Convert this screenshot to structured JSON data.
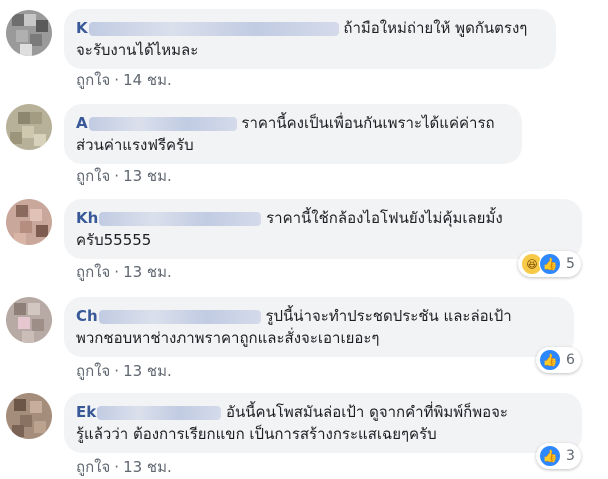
{
  "comments": [
    {
      "name_visible": "K",
      "text_line1": "ถ้ามือใหม่ถ่ายให้ พูดกันตรงๆ",
      "text_line2": "จะรับงานได้ไหมละ",
      "like_label": "ถูกใจ",
      "time": "14 ชม.",
      "reactions": null
    },
    {
      "name_visible": "A",
      "text_line1": "ราคานี้คงเป็นเพื่อนกันเพราะได้แค่ค่ารถ",
      "text_line2": "ส่วนค่าแรงฟรีครับ",
      "like_label": "ถูกใจ",
      "time": "13 ชม.",
      "reactions": null
    },
    {
      "name_visible": "Kh",
      "text_line1": "ราคานี้ใช้กล้องไอโฟนยังไม่คุ้มเลยมั้ง",
      "text_line2": "ครับ55555",
      "like_label": "ถูกใจ",
      "time": "13 ชม.",
      "reactions": {
        "count": "5",
        "icons": [
          "haha-icon",
          "like-icon"
        ]
      }
    },
    {
      "name_visible": "Ch",
      "text_line1": "รูปนี้น่าจะทำประชดประชัน และล่อเป้า",
      "text_line2": "พวกชอบหาช่างภาพราคาถูกและสั่งจะเอาเยอะๆ",
      "like_label": "ถูกใจ",
      "time": "13 ชม.",
      "reactions": {
        "count": "6",
        "icons": [
          "like-icon"
        ]
      }
    },
    {
      "name_visible": "Ek",
      "text_line1": "อันนี้คนโพสมันล่อเป้า ดูจากคำที่พิมพ์ก็พอจะ",
      "text_line2": "รู้แล้วว่า ต้องการเรียกแขก เป็นการสร้างกระแสเฉยๆครับ",
      "like_label": "ถูกใจ",
      "time": "13 ชม.",
      "reactions": {
        "count": "3",
        "icons": [
          "like-icon"
        ]
      }
    }
  ],
  "separator": "·",
  "colors": {
    "name": "#385898",
    "bubble": "#f2f3f5",
    "meta": "#606770",
    "like_reaction": "#2d88ff"
  }
}
